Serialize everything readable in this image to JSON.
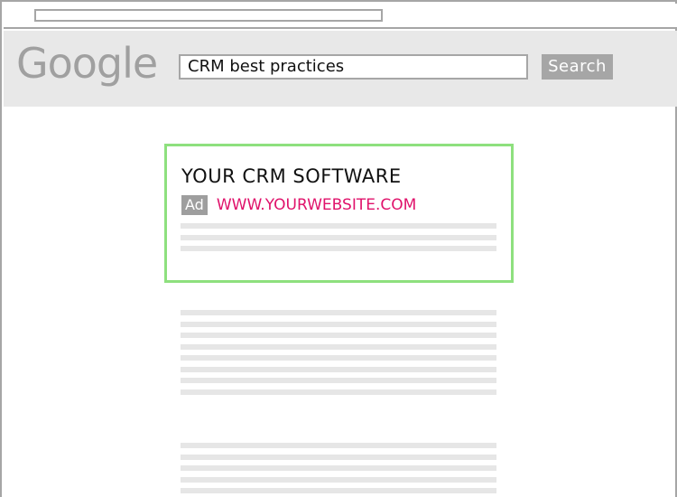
{
  "search": {
    "logo_text": "Google",
    "query": "CRM best practices",
    "button_label": "Search"
  },
  "ad": {
    "title": "YOUR CRM SOFTWARE",
    "badge": "Ad",
    "url": "WWW.YOURWEBSITE.COM"
  },
  "colors": {
    "ad_border": "#8ee07e",
    "ad_url": "#e0126b",
    "header_bg": "#e8e8e8",
    "placeholder_line": "#e6e6e6",
    "button_bg": "#a6a6a6"
  }
}
